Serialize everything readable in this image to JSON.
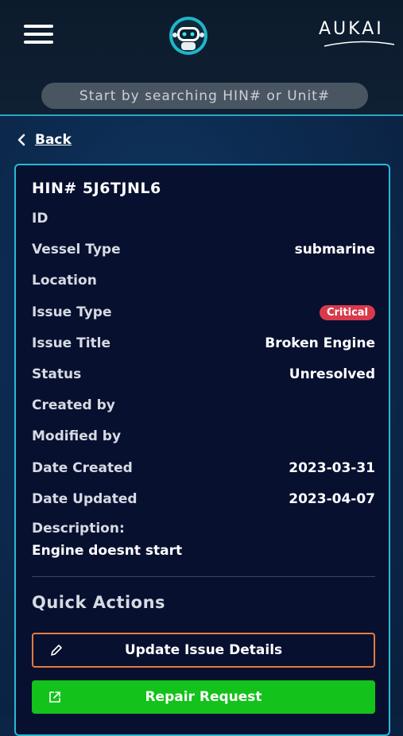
{
  "header": {
    "brand": "AUKAI",
    "search_placeholder": "Start by searching HIN# or Unit#"
  },
  "nav": {
    "back_label": "Back"
  },
  "issue": {
    "hin": "HIN# 5J6TJNL6",
    "fields": [
      {
        "key": "ID",
        "value": ""
      },
      {
        "key": "Vessel Type",
        "value": "submarine"
      },
      {
        "key": "Location",
        "value": ""
      },
      {
        "key": "Issue Type",
        "value": "Critical"
      },
      {
        "key": "Issue Title",
        "value": "Broken Engine"
      },
      {
        "key": "Status",
        "value": "Unresolved"
      },
      {
        "key": "Created by",
        "value": ""
      },
      {
        "key": "Modified by",
        "value": ""
      },
      {
        "key": "Date Created",
        "value": "2023-03-31"
      },
      {
        "key": "Date Updated",
        "value": "2023-04-07"
      }
    ],
    "description_label": "Description:",
    "description": "Engine doesnt start"
  },
  "quick_actions": {
    "title": "Quick Actions",
    "update_label": "Update Issue Details",
    "repair_label": "Repair Request"
  },
  "colors": {
    "accent_cyan": "#28b9d6",
    "critical_badge": "#d83a4c",
    "update_border": "#e47c3c",
    "repair_button": "#13c21a"
  },
  "icons": {
    "menu": "hamburger-menu-icon",
    "logo": "robot-logo",
    "back": "chevron-left-icon",
    "update": "pencil-icon",
    "repair": "external-link-icon"
  }
}
